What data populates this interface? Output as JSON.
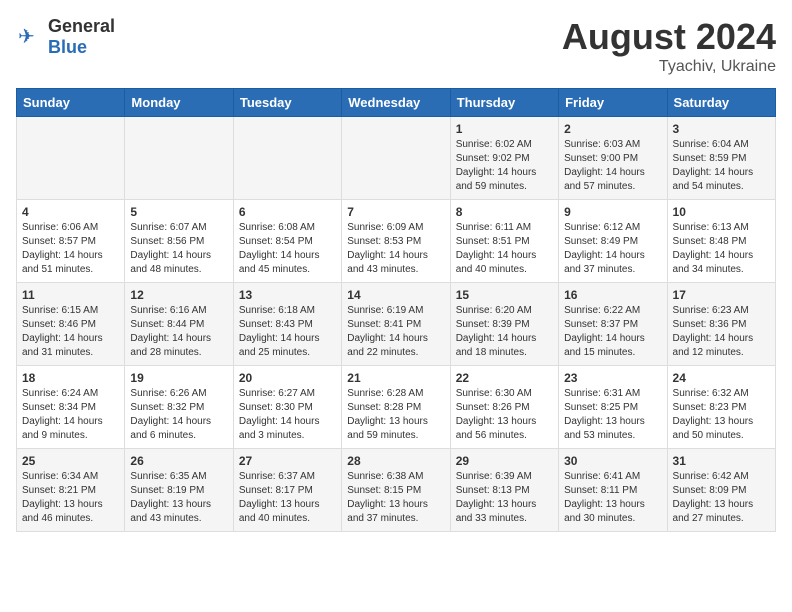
{
  "logo": {
    "text_general": "General",
    "text_blue": "Blue"
  },
  "title": "August 2024",
  "subtitle": "Tyachiv, Ukraine",
  "days_of_week": [
    "Sunday",
    "Monday",
    "Tuesday",
    "Wednesday",
    "Thursday",
    "Friday",
    "Saturday"
  ],
  "weeks": [
    [
      {
        "day": "",
        "info": ""
      },
      {
        "day": "",
        "info": ""
      },
      {
        "day": "",
        "info": ""
      },
      {
        "day": "",
        "info": ""
      },
      {
        "day": "1",
        "info": "Sunrise: 6:02 AM\nSunset: 9:02 PM\nDaylight: 14 hours\nand 59 minutes."
      },
      {
        "day": "2",
        "info": "Sunrise: 6:03 AM\nSunset: 9:00 PM\nDaylight: 14 hours\nand 57 minutes."
      },
      {
        "day": "3",
        "info": "Sunrise: 6:04 AM\nSunset: 8:59 PM\nDaylight: 14 hours\nand 54 minutes."
      }
    ],
    [
      {
        "day": "4",
        "info": "Sunrise: 6:06 AM\nSunset: 8:57 PM\nDaylight: 14 hours\nand 51 minutes."
      },
      {
        "day": "5",
        "info": "Sunrise: 6:07 AM\nSunset: 8:56 PM\nDaylight: 14 hours\nand 48 minutes."
      },
      {
        "day": "6",
        "info": "Sunrise: 6:08 AM\nSunset: 8:54 PM\nDaylight: 14 hours\nand 45 minutes."
      },
      {
        "day": "7",
        "info": "Sunrise: 6:09 AM\nSunset: 8:53 PM\nDaylight: 14 hours\nand 43 minutes."
      },
      {
        "day": "8",
        "info": "Sunrise: 6:11 AM\nSunset: 8:51 PM\nDaylight: 14 hours\nand 40 minutes."
      },
      {
        "day": "9",
        "info": "Sunrise: 6:12 AM\nSunset: 8:49 PM\nDaylight: 14 hours\nand 37 minutes."
      },
      {
        "day": "10",
        "info": "Sunrise: 6:13 AM\nSunset: 8:48 PM\nDaylight: 14 hours\nand 34 minutes."
      }
    ],
    [
      {
        "day": "11",
        "info": "Sunrise: 6:15 AM\nSunset: 8:46 PM\nDaylight: 14 hours\nand 31 minutes."
      },
      {
        "day": "12",
        "info": "Sunrise: 6:16 AM\nSunset: 8:44 PM\nDaylight: 14 hours\nand 28 minutes."
      },
      {
        "day": "13",
        "info": "Sunrise: 6:18 AM\nSunset: 8:43 PM\nDaylight: 14 hours\nand 25 minutes."
      },
      {
        "day": "14",
        "info": "Sunrise: 6:19 AM\nSunset: 8:41 PM\nDaylight: 14 hours\nand 22 minutes."
      },
      {
        "day": "15",
        "info": "Sunrise: 6:20 AM\nSunset: 8:39 PM\nDaylight: 14 hours\nand 18 minutes."
      },
      {
        "day": "16",
        "info": "Sunrise: 6:22 AM\nSunset: 8:37 PM\nDaylight: 14 hours\nand 15 minutes."
      },
      {
        "day": "17",
        "info": "Sunrise: 6:23 AM\nSunset: 8:36 PM\nDaylight: 14 hours\nand 12 minutes."
      }
    ],
    [
      {
        "day": "18",
        "info": "Sunrise: 6:24 AM\nSunset: 8:34 PM\nDaylight: 14 hours\nand 9 minutes."
      },
      {
        "day": "19",
        "info": "Sunrise: 6:26 AM\nSunset: 8:32 PM\nDaylight: 14 hours\nand 6 minutes."
      },
      {
        "day": "20",
        "info": "Sunrise: 6:27 AM\nSunset: 8:30 PM\nDaylight: 14 hours\nand 3 minutes."
      },
      {
        "day": "21",
        "info": "Sunrise: 6:28 AM\nSunset: 8:28 PM\nDaylight: 13 hours\nand 59 minutes."
      },
      {
        "day": "22",
        "info": "Sunrise: 6:30 AM\nSunset: 8:26 PM\nDaylight: 13 hours\nand 56 minutes."
      },
      {
        "day": "23",
        "info": "Sunrise: 6:31 AM\nSunset: 8:25 PM\nDaylight: 13 hours\nand 53 minutes."
      },
      {
        "day": "24",
        "info": "Sunrise: 6:32 AM\nSunset: 8:23 PM\nDaylight: 13 hours\nand 50 minutes."
      }
    ],
    [
      {
        "day": "25",
        "info": "Sunrise: 6:34 AM\nSunset: 8:21 PM\nDaylight: 13 hours\nand 46 minutes."
      },
      {
        "day": "26",
        "info": "Sunrise: 6:35 AM\nSunset: 8:19 PM\nDaylight: 13 hours\nand 43 minutes."
      },
      {
        "day": "27",
        "info": "Sunrise: 6:37 AM\nSunset: 8:17 PM\nDaylight: 13 hours\nand 40 minutes."
      },
      {
        "day": "28",
        "info": "Sunrise: 6:38 AM\nSunset: 8:15 PM\nDaylight: 13 hours\nand 37 minutes."
      },
      {
        "day": "29",
        "info": "Sunrise: 6:39 AM\nSunset: 8:13 PM\nDaylight: 13 hours\nand 33 minutes."
      },
      {
        "day": "30",
        "info": "Sunrise: 6:41 AM\nSunset: 8:11 PM\nDaylight: 13 hours\nand 30 minutes."
      },
      {
        "day": "31",
        "info": "Sunrise: 6:42 AM\nSunset: 8:09 PM\nDaylight: 13 hours\nand 27 minutes."
      }
    ]
  ]
}
